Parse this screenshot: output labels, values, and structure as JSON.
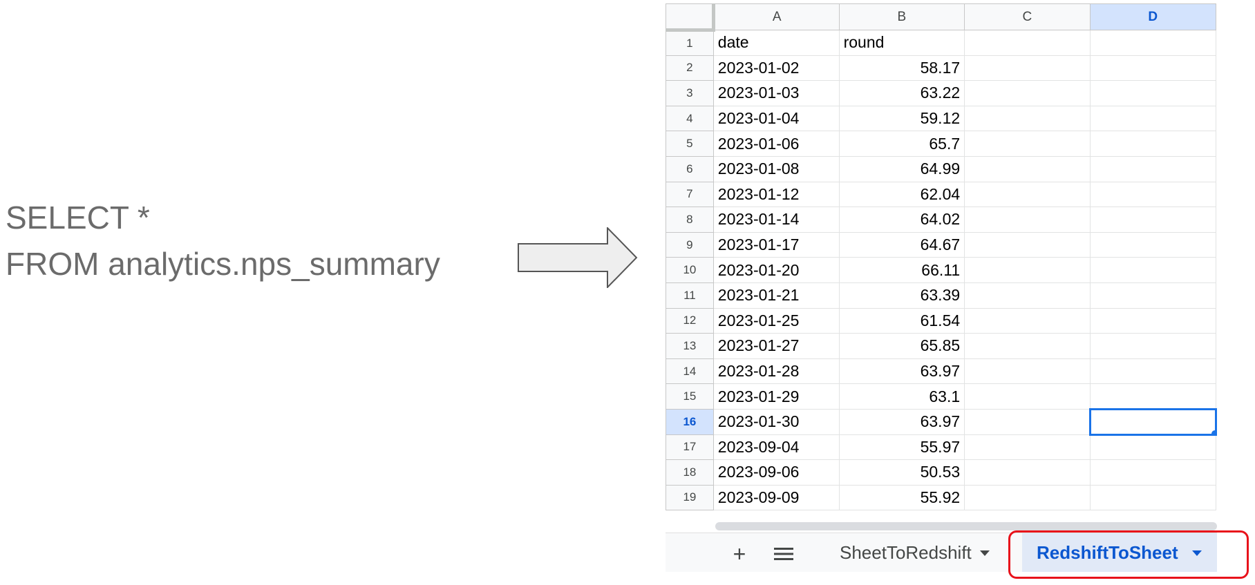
{
  "query": {
    "line1": "SELECT *",
    "line2": "FROM analytics.nps_summary"
  },
  "arrow": {
    "icon": "right-arrow-icon",
    "fill": "#eeeeee",
    "stroke": "#555555"
  },
  "spreadsheet": {
    "columns": [
      "A",
      "B",
      "C",
      "D"
    ],
    "selected_column": "D",
    "selected_row": 16,
    "rows": [
      {
        "n": "1",
        "a": "date",
        "b": "round"
      },
      {
        "n": "2",
        "a": "2023-01-02",
        "b": "58.17"
      },
      {
        "n": "3",
        "a": "2023-01-03",
        "b": "63.22"
      },
      {
        "n": "4",
        "a": "2023-01-04",
        "b": "59.12"
      },
      {
        "n": "5",
        "a": "2023-01-06",
        "b": "65.7"
      },
      {
        "n": "6",
        "a": "2023-01-08",
        "b": "64.99"
      },
      {
        "n": "7",
        "a": "2023-01-12",
        "b": "62.04"
      },
      {
        "n": "8",
        "a": "2023-01-14",
        "b": "64.02"
      },
      {
        "n": "9",
        "a": "2023-01-17",
        "b": "64.67"
      },
      {
        "n": "10",
        "a": "2023-01-20",
        "b": "66.11"
      },
      {
        "n": "11",
        "a": "2023-01-21",
        "b": "63.39"
      },
      {
        "n": "12",
        "a": "2023-01-25",
        "b": "61.54"
      },
      {
        "n": "13",
        "a": "2023-01-27",
        "b": "65.85"
      },
      {
        "n": "14",
        "a": "2023-01-28",
        "b": "63.97"
      },
      {
        "n": "15",
        "a": "2023-01-29",
        "b": "63.1"
      },
      {
        "n": "16",
        "a": "2023-01-30",
        "b": "63.97"
      },
      {
        "n": "17",
        "a": "2023-09-04",
        "b": "55.97"
      },
      {
        "n": "18",
        "a": "2023-09-06",
        "b": "50.53"
      },
      {
        "n": "19",
        "a": "2023-09-09",
        "b": "55.92"
      }
    ]
  },
  "tabbar": {
    "add_icon": "plus-icon",
    "add_glyph": "+",
    "menu_icon": "hamburger-menu-icon",
    "menu_glyph": "≡",
    "tabs": [
      {
        "label": "SheetToRedshift",
        "active": false
      },
      {
        "label": "RedshiftToSheet",
        "active": true
      }
    ]
  },
  "colors": {
    "highlight": "#e8121b",
    "selection": "#1a73e8",
    "selected_header_bg": "#d3e3fd"
  }
}
